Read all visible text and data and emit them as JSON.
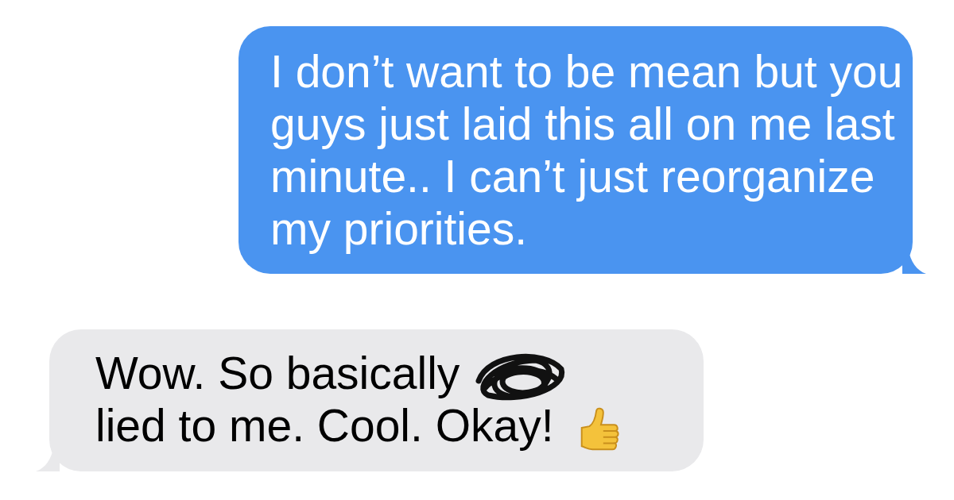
{
  "messages": [
    {
      "kind": "sent",
      "parts": [
        {
          "kind": "text",
          "text": "I don’t want to be mean but you guys just laid this all on me last minute.. I can’t just reorganize my priorities."
        }
      ]
    },
    {
      "kind": "received",
      "parts": [
        {
          "kind": "text",
          "text": "Wow. So basically"
        },
        {
          "kind": "redaction"
        },
        {
          "kind": "text",
          "text": "lied to"
        },
        {
          "kind": "text",
          "text": "me. Cool. Okay!"
        },
        {
          "kind": "thumbs-up"
        }
      ]
    }
  ]
}
